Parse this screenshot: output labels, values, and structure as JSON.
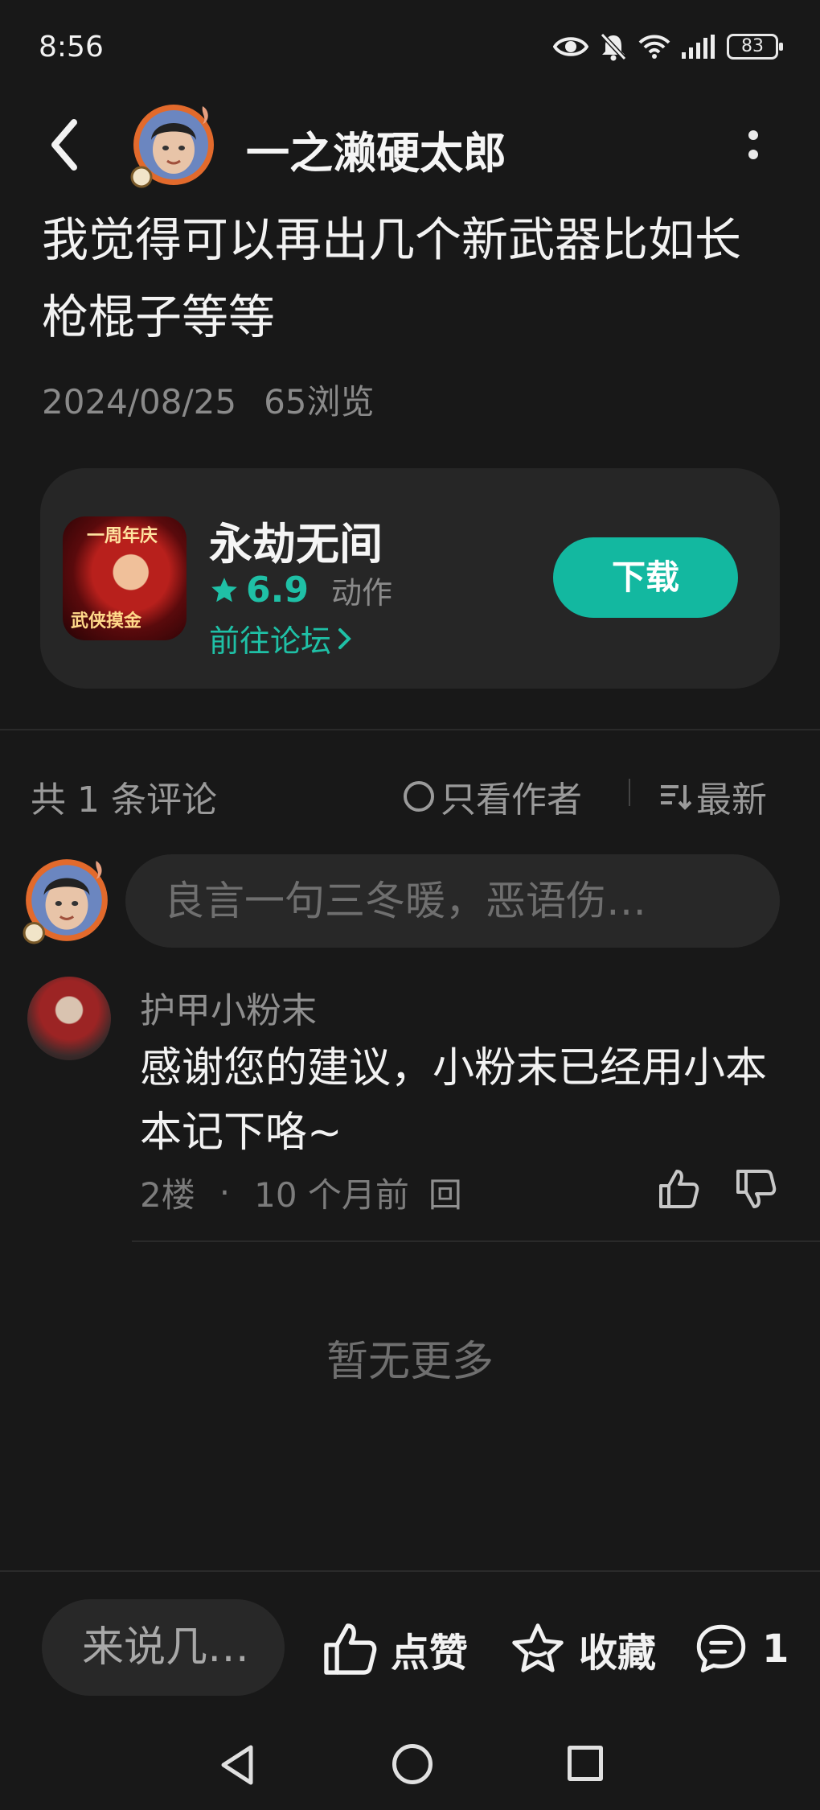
{
  "status_bar": {
    "time": "8:56",
    "battery": "83"
  },
  "header": {
    "author_name": "一之濑硬太郎"
  },
  "post": {
    "body": "我觉得可以再出几个新武器比如长枪棍子等等",
    "date": "2024/08/25",
    "views": "65浏览"
  },
  "game_card": {
    "title": "永劫无间",
    "rating": "6.9",
    "genre": "动作",
    "forum_link": "前往论坛",
    "download_label": "下载",
    "icon_text_top": "一周年庆",
    "icon_text_bottom": "武侠摸金"
  },
  "comments_header": {
    "count": "共 1 条评论",
    "author_only": "只看作者",
    "sort": "最新"
  },
  "comment_input": {
    "placeholder": "良言一句三冬暖，恶语伤…"
  },
  "comments": [
    {
      "author": "护甲小粉末",
      "text": "感谢您的建议，小粉末已经用小本本记下咯~",
      "floor": "2楼",
      "time": "10 个月前",
      "reply_label": "回"
    }
  ],
  "no_more": "暂无更多",
  "bottom_bar": {
    "input_placeholder": "来说几…",
    "like_label": "点赞",
    "favorite_label": "收藏",
    "comment_count": "1"
  },
  "colors": {
    "accent": "#13b8a0",
    "background": "#181818",
    "card": "#262626"
  },
  "icons": [
    "eye-icon",
    "mute-bell-icon",
    "wifi-icon",
    "signal-icon",
    "battery-icon",
    "back-arrow-icon",
    "more-vertical-icon",
    "star-icon",
    "chevron-right-icon",
    "sort-icon",
    "thumb-up-icon",
    "thumb-down-icon",
    "star-outline-icon",
    "comment-bubble-icon"
  ]
}
